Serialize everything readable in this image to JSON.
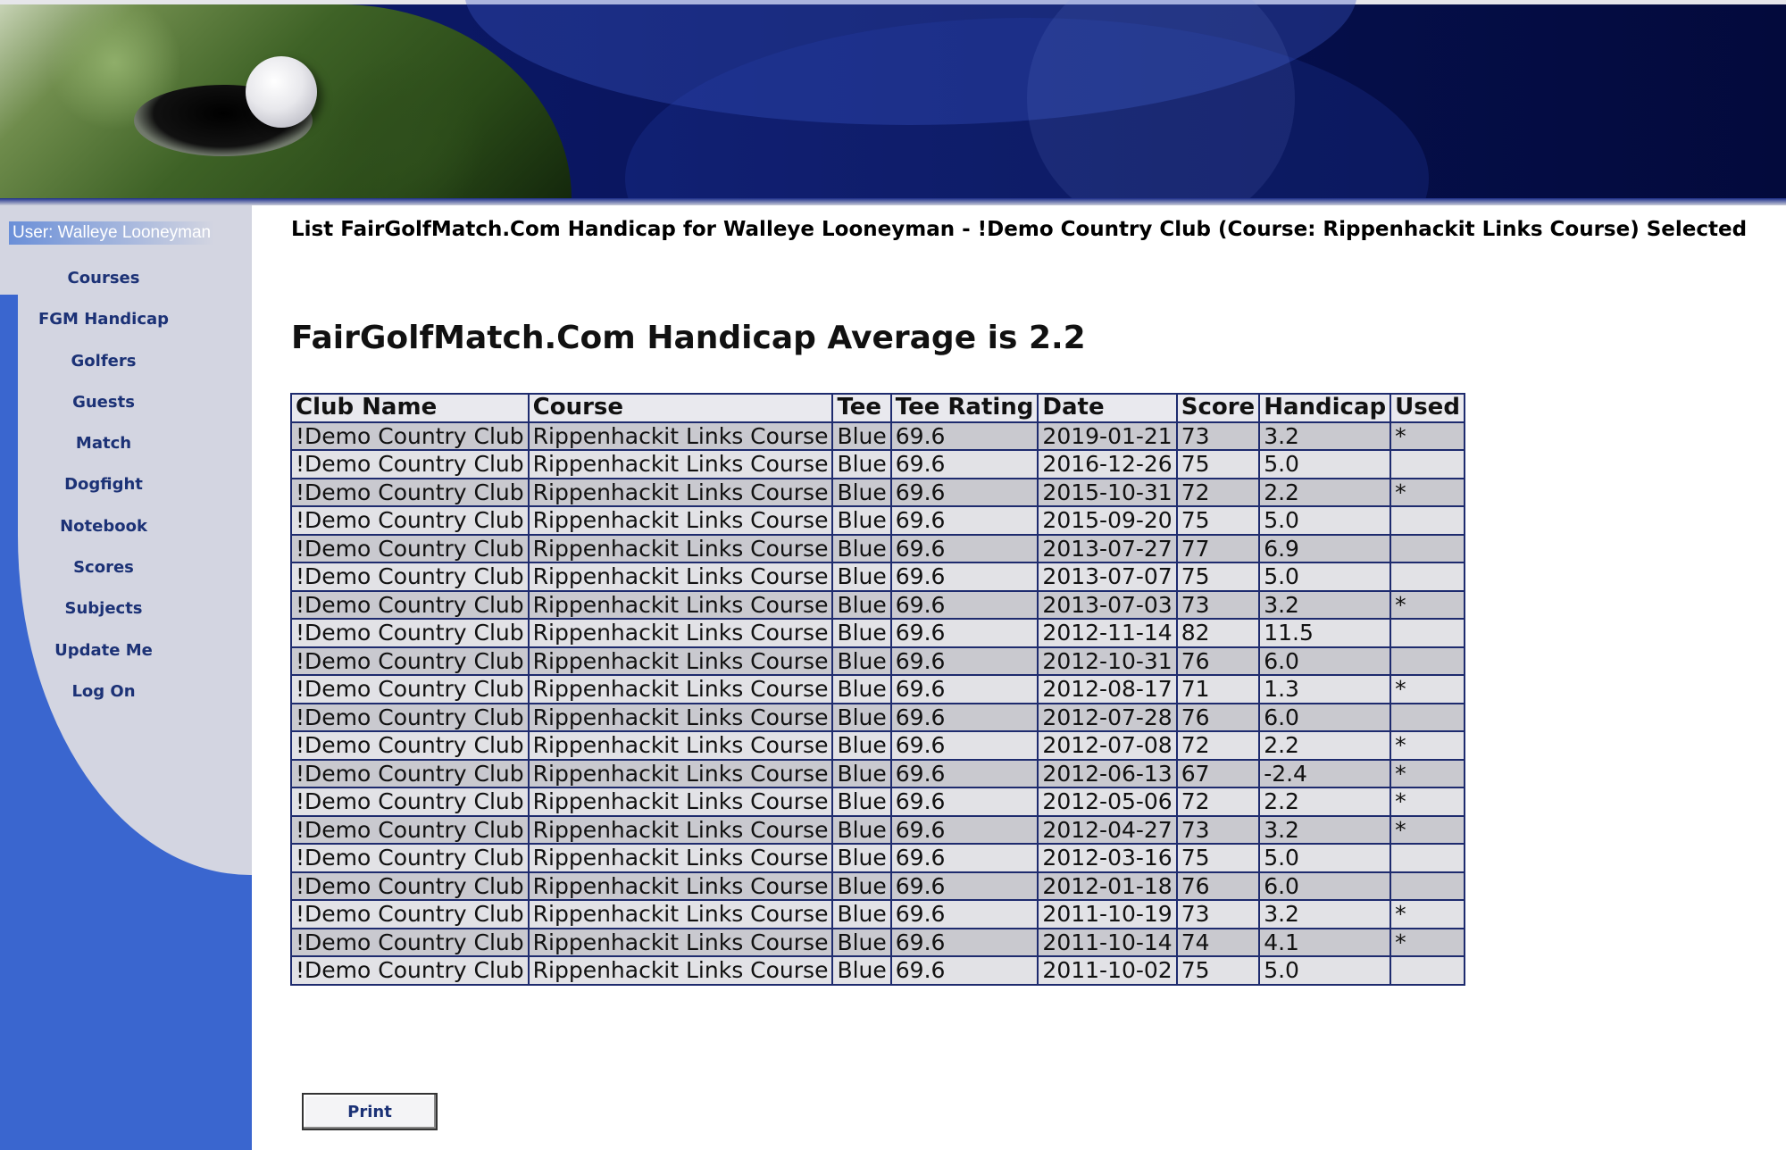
{
  "sidebar": {
    "user_label": "User: Walleye Looneyman",
    "items": [
      {
        "label": "Courses"
      },
      {
        "label": "FGM Handicap"
      },
      {
        "label": "Golfers"
      },
      {
        "label": "Guests"
      },
      {
        "label": "Match"
      },
      {
        "label": "Dogfight"
      },
      {
        "label": "Notebook"
      },
      {
        "label": "Scores"
      },
      {
        "label": "Subjects"
      },
      {
        "label": "Update Me"
      },
      {
        "label": "Log On"
      }
    ]
  },
  "main": {
    "page_heading": "List FairGolfMatch.Com Handicap for Walleye Looneyman - !Demo Country Club (Course: Rippenhackit Links Course) Selected",
    "average_heading": "FairGolfMatch.Com Handicap Average is 2.2",
    "print_label": "Print"
  },
  "table": {
    "headers": [
      "Club Name",
      "Course",
      "Tee",
      "Tee Rating",
      "Date",
      "Score",
      "Handicap",
      "Used"
    ],
    "rows": [
      [
        "!Demo Country Club",
        "Rippenhackit Links Course",
        "Blue",
        "69.6",
        "2019-01-21",
        "73",
        "3.2",
        "*"
      ],
      [
        "!Demo Country Club",
        "Rippenhackit Links Course",
        "Blue",
        "69.6",
        "2016-12-26",
        "75",
        "5.0",
        ""
      ],
      [
        "!Demo Country Club",
        "Rippenhackit Links Course",
        "Blue",
        "69.6",
        "2015-10-31",
        "72",
        "2.2",
        "*"
      ],
      [
        "!Demo Country Club",
        "Rippenhackit Links Course",
        "Blue",
        "69.6",
        "2015-09-20",
        "75",
        "5.0",
        ""
      ],
      [
        "!Demo Country Club",
        "Rippenhackit Links Course",
        "Blue",
        "69.6",
        "2013-07-27",
        "77",
        "6.9",
        ""
      ],
      [
        "!Demo Country Club",
        "Rippenhackit Links Course",
        "Blue",
        "69.6",
        "2013-07-07",
        "75",
        "5.0",
        ""
      ],
      [
        "!Demo Country Club",
        "Rippenhackit Links Course",
        "Blue",
        "69.6",
        "2013-07-03",
        "73",
        "3.2",
        "*"
      ],
      [
        "!Demo Country Club",
        "Rippenhackit Links Course",
        "Blue",
        "69.6",
        "2012-11-14",
        "82",
        "11.5",
        ""
      ],
      [
        "!Demo Country Club",
        "Rippenhackit Links Course",
        "Blue",
        "69.6",
        "2012-10-31",
        "76",
        "6.0",
        ""
      ],
      [
        "!Demo Country Club",
        "Rippenhackit Links Course",
        "Blue",
        "69.6",
        "2012-08-17",
        "71",
        "1.3",
        "*"
      ],
      [
        "!Demo Country Club",
        "Rippenhackit Links Course",
        "Blue",
        "69.6",
        "2012-07-28",
        "76",
        "6.0",
        ""
      ],
      [
        "!Demo Country Club",
        "Rippenhackit Links Course",
        "Blue",
        "69.6",
        "2012-07-08",
        "72",
        "2.2",
        "*"
      ],
      [
        "!Demo Country Club",
        "Rippenhackit Links Course",
        "Blue",
        "69.6",
        "2012-06-13",
        "67",
        "-2.4",
        "*"
      ],
      [
        "!Demo Country Club",
        "Rippenhackit Links Course",
        "Blue",
        "69.6",
        "2012-05-06",
        "72",
        "2.2",
        "*"
      ],
      [
        "!Demo Country Club",
        "Rippenhackit Links Course",
        "Blue",
        "69.6",
        "2012-04-27",
        "73",
        "3.2",
        "*"
      ],
      [
        "!Demo Country Club",
        "Rippenhackit Links Course",
        "Blue",
        "69.6",
        "2012-03-16",
        "75",
        "5.0",
        ""
      ],
      [
        "!Demo Country Club",
        "Rippenhackit Links Course",
        "Blue",
        "69.6",
        "2012-01-18",
        "76",
        "6.0",
        ""
      ],
      [
        "!Demo Country Club",
        "Rippenhackit Links Course",
        "Blue",
        "69.6",
        "2011-10-19",
        "73",
        "3.2",
        "*"
      ],
      [
        "!Demo Country Club",
        "Rippenhackit Links Course",
        "Blue",
        "69.6",
        "2011-10-14",
        "74",
        "4.1",
        "*"
      ],
      [
        "!Demo Country Club",
        "Rippenhackit Links Course",
        "Blue",
        "69.6",
        "2011-10-02",
        "75",
        "5.0",
        ""
      ]
    ]
  },
  "colors": {
    "banner_navy": "#0a1660",
    "sidebar_blue": "#3a66cf",
    "sidebar_pale": "#d3d5e1",
    "nav_text": "#1c3276",
    "table_border": "#1e2b6e",
    "row_dark": "#c9c9cf",
    "row_light": "#e2e2e6"
  },
  "icons": {
    "banner": "golf-ball-hole-icon"
  }
}
